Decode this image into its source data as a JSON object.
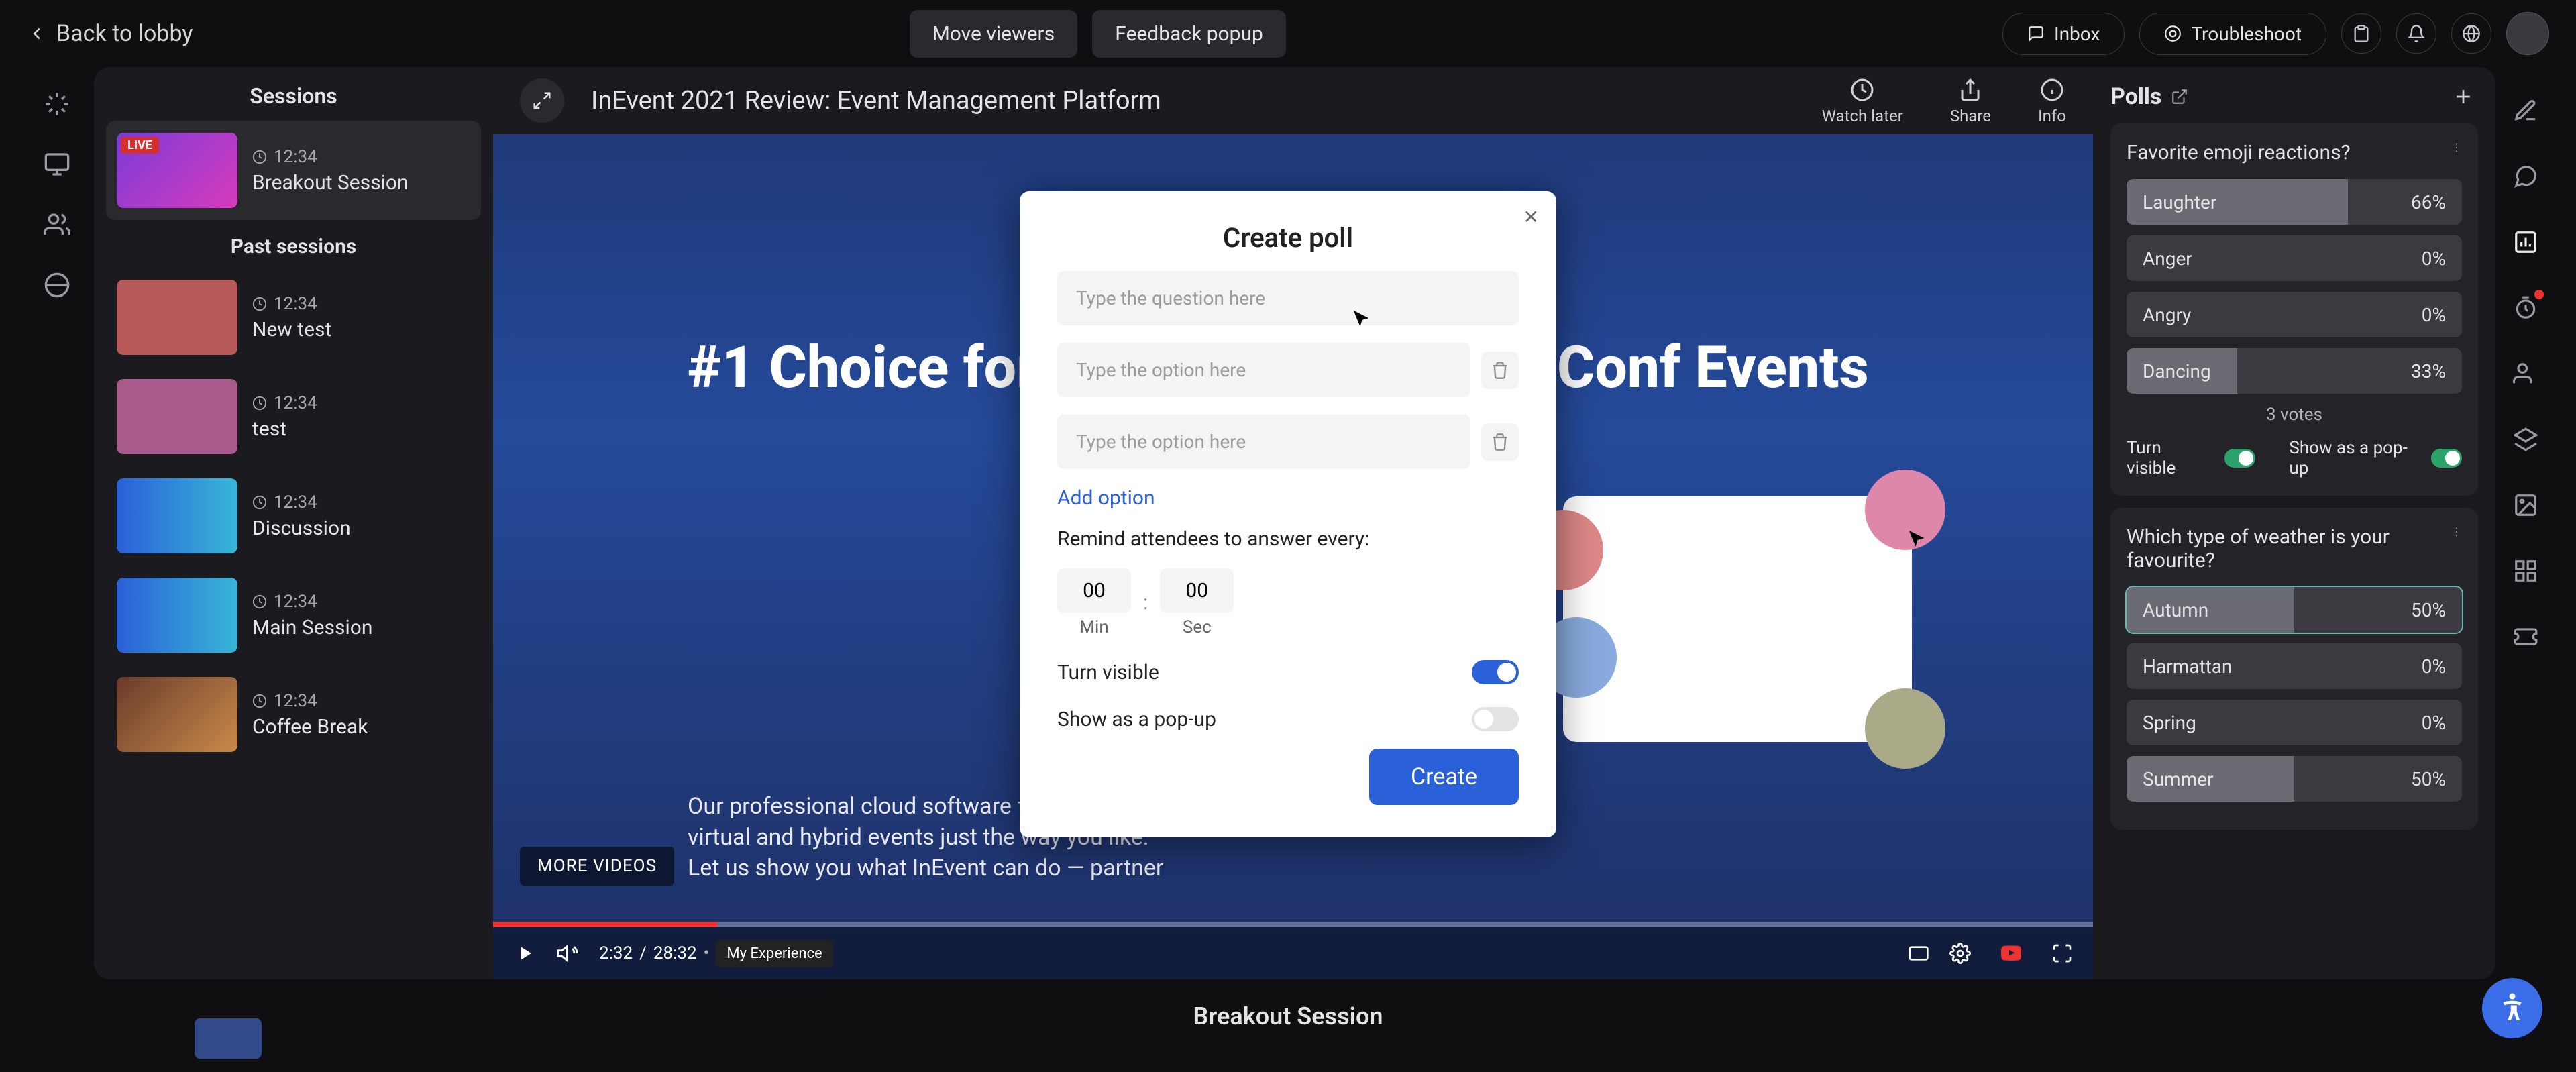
{
  "topbar": {
    "back": "Back to lobby",
    "move_viewers": "Move viewers",
    "feedback_popup": "Feedback popup",
    "inbox": "Inbox",
    "troubleshoot": "Troubleshoot"
  },
  "sidebar": {
    "title": "Sessions",
    "current": {
      "time": "12:34",
      "name": "Breakout Session",
      "live": "LIVE"
    },
    "past_heading": "Past sessions",
    "past": [
      {
        "time": "12:34",
        "name": "New test"
      },
      {
        "time": "12:34",
        "name": "test"
      },
      {
        "time": "12:34",
        "name": "Discussion"
      },
      {
        "time": "12:34",
        "name": "Main Session"
      },
      {
        "time": "12:34",
        "name": "Coffee Break"
      }
    ]
  },
  "video": {
    "title": "InEvent 2021 Review: Event Management Platform",
    "watch_later": "Watch later",
    "share": "Share",
    "info": "Info",
    "site_headline": "#1 Choice for Virtual & In Person Conf Events",
    "site_sub": "Our professional cloud software for all your in-person, virtual and hybrid events just the way you like.\nLet us show you what InEvent can do — partner",
    "more_videos": "MORE VIDEOS",
    "player": {
      "current": "2:32",
      "total": "28:32",
      "experience": "My Experience"
    }
  },
  "bottom": {
    "current_session": "Breakout Session"
  },
  "polls_panel": {
    "title": "Polls",
    "poll_a": {
      "question": "Favorite emoji reactions?",
      "options": [
        {
          "label": "Laughter",
          "pct": "66%",
          "fill": 66
        },
        {
          "label": "Anger",
          "pct": "0%",
          "fill": 0
        },
        {
          "label": "Angry",
          "pct": "0%",
          "fill": 0
        },
        {
          "label": "Dancing",
          "pct": "33%",
          "fill": 33
        }
      ],
      "votes": "3 votes",
      "turn_visible": "Turn visible",
      "show_popup": "Show as a pop-up"
    },
    "poll_b": {
      "question": "Which type of weather is your favourite?",
      "options": [
        {
          "label": "Autumn",
          "pct": "50%",
          "fill": 50,
          "selected": true
        },
        {
          "label": "Harmattan",
          "pct": "0%",
          "fill": 0
        },
        {
          "label": "Spring",
          "pct": "0%",
          "fill": 0
        },
        {
          "label": "Summer",
          "pct": "50%",
          "fill": 50
        }
      ]
    }
  },
  "modal": {
    "heading": "Create poll",
    "question_placeholder": "Type the question here",
    "option_placeholder": "Type the option here",
    "add_option": "Add option",
    "remind_label": "Remind attendees to answer every:",
    "min_val": "00",
    "sec_val": "00",
    "min_label": "Min",
    "sec_label": "Sec",
    "turn_visible": "Turn visible",
    "show_popup": "Show as a pop-up",
    "create_btn": "Create"
  },
  "icons": {
    "arrow_left": "←",
    "plus": "+",
    "close": "✕",
    "trash": "🗑",
    "clock": "⏱",
    "overflow": "⋮",
    "external": "↗"
  }
}
